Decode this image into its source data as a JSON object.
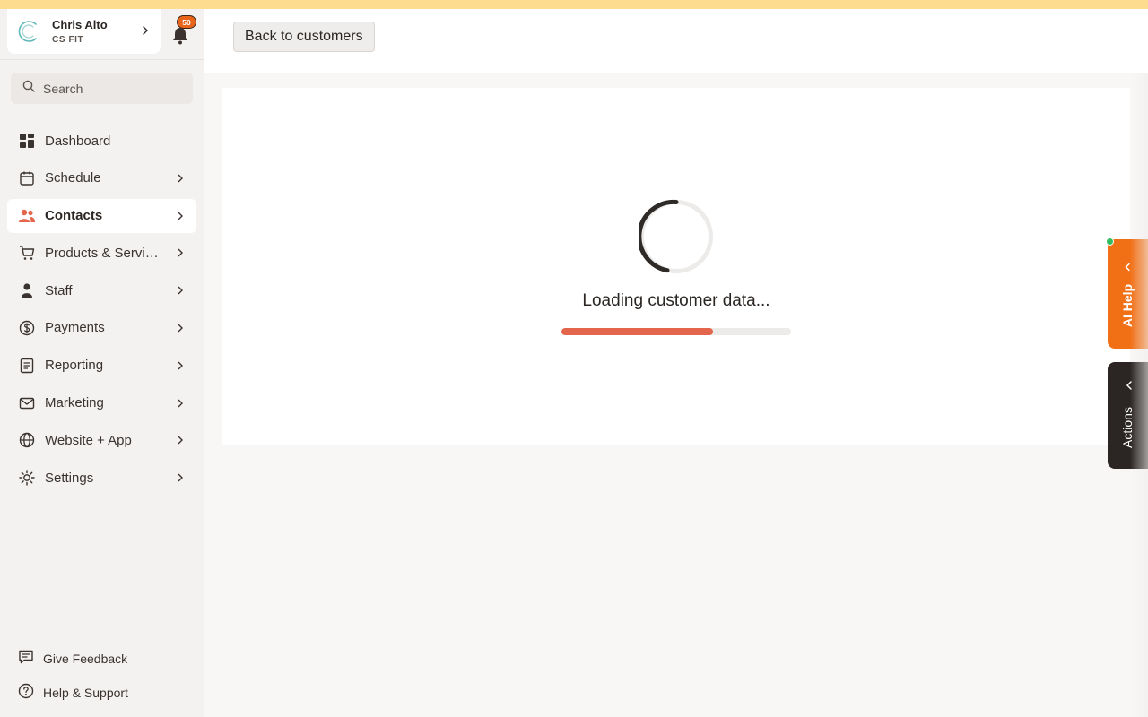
{
  "account": {
    "name": "Chris Alto",
    "org": "CS FIT"
  },
  "notifications": {
    "count": "50"
  },
  "search": {
    "placeholder": "Search"
  },
  "nav": {
    "items": [
      {
        "label": "Dashboard",
        "icon": "dashboard-icon"
      },
      {
        "label": "Schedule",
        "icon": "calendar-icon"
      },
      {
        "label": "Contacts",
        "icon": "contacts-icon"
      },
      {
        "label": "Products & Services",
        "icon": "cart-icon"
      },
      {
        "label": "Staff",
        "icon": "person-icon"
      },
      {
        "label": "Payments",
        "icon": "dollar-icon"
      },
      {
        "label": "Reporting",
        "icon": "report-icon"
      },
      {
        "label": "Marketing",
        "icon": "mail-icon"
      },
      {
        "label": "Website + App",
        "icon": "globe-icon"
      },
      {
        "label": "Settings",
        "icon": "gear-icon"
      }
    ],
    "active": "Contacts"
  },
  "footer": {
    "feedback": "Give Feedback",
    "help": "Help & Support"
  },
  "header": {
    "back_label": "Back to customers"
  },
  "loading": {
    "text": "Loading customer data...",
    "progress_percent": 66
  },
  "ai_tab": {
    "label": "AI Help"
  },
  "actions_tab": {
    "label": "Actions"
  },
  "colors": {
    "accent": "#e3654c",
    "ai_orange": "#f16f15",
    "banner": "#fddc8f",
    "status_green": "#2fbd5f"
  }
}
